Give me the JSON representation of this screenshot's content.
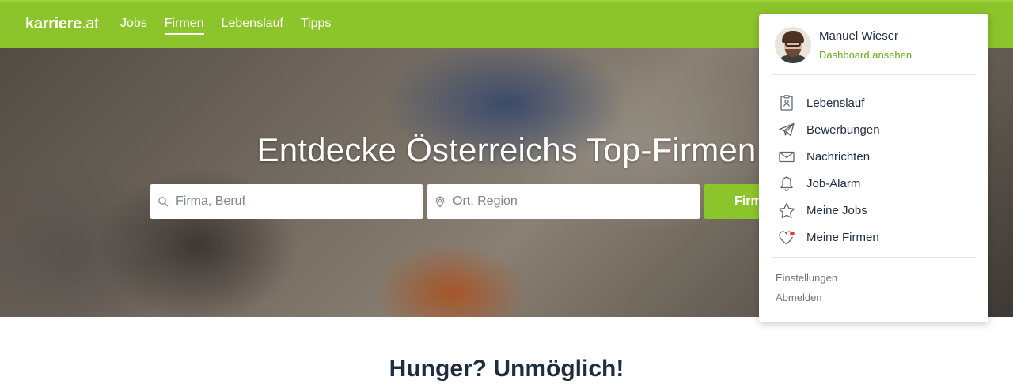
{
  "brand": {
    "name": "karriere",
    "tld": ".at"
  },
  "nav": {
    "items": [
      "Jobs",
      "Firmen",
      "Lebenslauf",
      "Tipps"
    ],
    "active": "Firmen"
  },
  "hero": {
    "title": "Entdecke Österreichs Top-Firmen",
    "search_company_placeholder": "Firma, Beruf",
    "search_location_placeholder": "Ort, Region",
    "search_button": "Firmen"
  },
  "section": {
    "title": "Hunger? Unmöglich!"
  },
  "user_menu": {
    "name": "Manuel Wieser",
    "dashboard_link": "Dashboard ansehen",
    "items": [
      {
        "label": "Lebenslauf",
        "icon": "resume-icon"
      },
      {
        "label": "Bewerbungen",
        "icon": "paper-plane-icon"
      },
      {
        "label": "Nachrichten",
        "icon": "envelope-icon"
      },
      {
        "label": "Job-Alarm",
        "icon": "bell-icon"
      },
      {
        "label": "Meine Jobs",
        "icon": "star-icon"
      },
      {
        "label": "Meine Firmen",
        "icon": "heart-icon",
        "has_notification": true
      }
    ],
    "settings": "Einstellungen",
    "logout": "Abmelden"
  },
  "colors": {
    "brand_green": "#8cc42b",
    "link_green": "#6aaa1e",
    "text_dark": "#1f2d3d",
    "notification_red": "#e53935"
  }
}
